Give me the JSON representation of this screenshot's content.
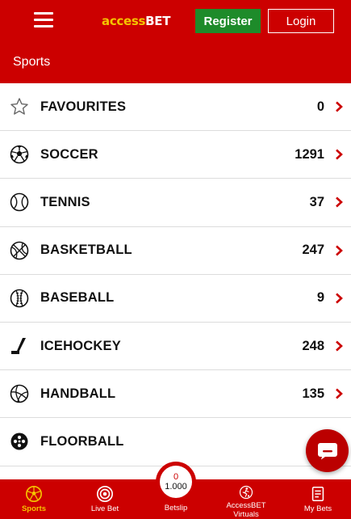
{
  "header": {
    "logo_part1": "access",
    "logo_part2": "BET",
    "register_label": "Register",
    "login_label": "Login",
    "section_title": "Sports"
  },
  "sports": [
    {
      "label": "FAVOURITES",
      "count": "0",
      "icon": "star-icon"
    },
    {
      "label": "SOCCER",
      "count": "1291",
      "icon": "soccer-ball-icon"
    },
    {
      "label": "TENNIS",
      "count": "37",
      "icon": "tennis-ball-icon"
    },
    {
      "label": "BASKETBALL",
      "count": "247",
      "icon": "basketball-icon"
    },
    {
      "label": "BASEBALL",
      "count": "9",
      "icon": "baseball-icon"
    },
    {
      "label": "ICEHOCKEY",
      "count": "248",
      "icon": "hockey-stick-icon"
    },
    {
      "label": "HANDBALL",
      "count": "135",
      "icon": "handball-icon"
    },
    {
      "label": "FLOORBALL",
      "count": "",
      "icon": "floorball-icon"
    }
  ],
  "bottom_nav": {
    "sports": "Sports",
    "live_bet": "Live Bet",
    "betslip": "Betslip",
    "betslip_count": "0",
    "betslip_odds": "1.000",
    "virtuals_line1": "AccessBET",
    "virtuals_line2": "Virtuals",
    "my_bets": "My Bets"
  },
  "colors": {
    "brand_red": "#cc0000",
    "register_green": "#1e8b2a",
    "logo_yellow": "#f5c400",
    "active_nav": "#f5c400"
  }
}
